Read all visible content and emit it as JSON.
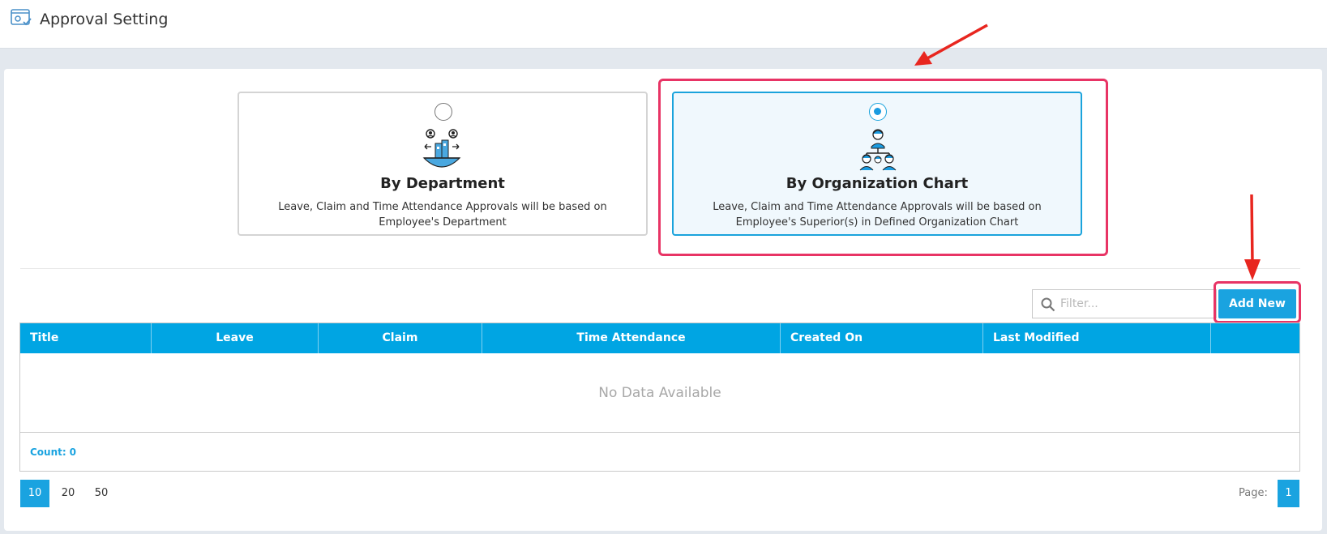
{
  "header": {
    "title": "Approval Setting",
    "icon": "settings-window-icon"
  },
  "options": [
    {
      "title": "By Department",
      "description": "Leave, Claim and Time Attendance Approvals will be based on Employee's Department",
      "selected": false,
      "icon": "department-people-icon"
    },
    {
      "title": "By Organization Chart",
      "description": "Leave, Claim and Time Attendance Approvals will be based on Employee's Superior(s) in Defined Organization Chart",
      "selected": true,
      "icon": "org-chart-icon"
    }
  ],
  "toolbar": {
    "filter_placeholder": "Filter...",
    "add_label": "Add New"
  },
  "grid": {
    "columns": [
      "Title",
      "Leave",
      "Claim",
      "Time Attendance",
      "Created On",
      "Last Modified",
      ""
    ],
    "empty_text": "No Data Available",
    "count_label": "Count:",
    "count_value": "0"
  },
  "pagination": {
    "page_sizes": [
      "10",
      "20",
      "50"
    ],
    "active_page_size": "10",
    "page_label": "Page:",
    "current_page": "1"
  },
  "colors": {
    "accent": "#1aa3e0",
    "header_bg": "#00a5e3",
    "annotation": "#e83465"
  }
}
